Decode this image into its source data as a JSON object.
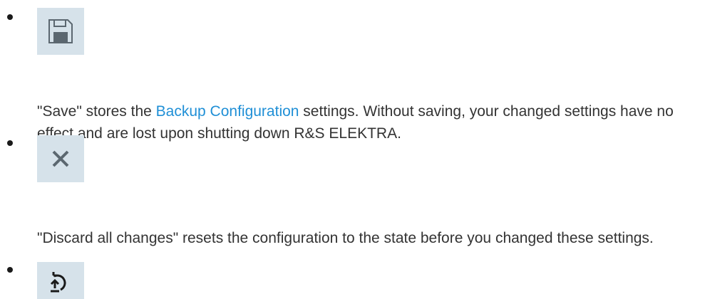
{
  "items": [
    {
      "icon": "save-icon",
      "prefix": "\"Save\" stores the ",
      "link": "Backup Configuration",
      "suffix": " settings. Without saving, your changed settings have no effect and are lost upon shutting down R&S ELEKTRA."
    },
    {
      "icon": "close-icon",
      "text": "\"Discard all changes\" resets the configuration to the state before you changed these settings."
    },
    {
      "icon": "restore-icon"
    }
  ],
  "colors": {
    "icon_background": "#d6e2ea",
    "icon_foreground": "#5b6770",
    "link": "#1f8fd6",
    "text": "#333333"
  }
}
